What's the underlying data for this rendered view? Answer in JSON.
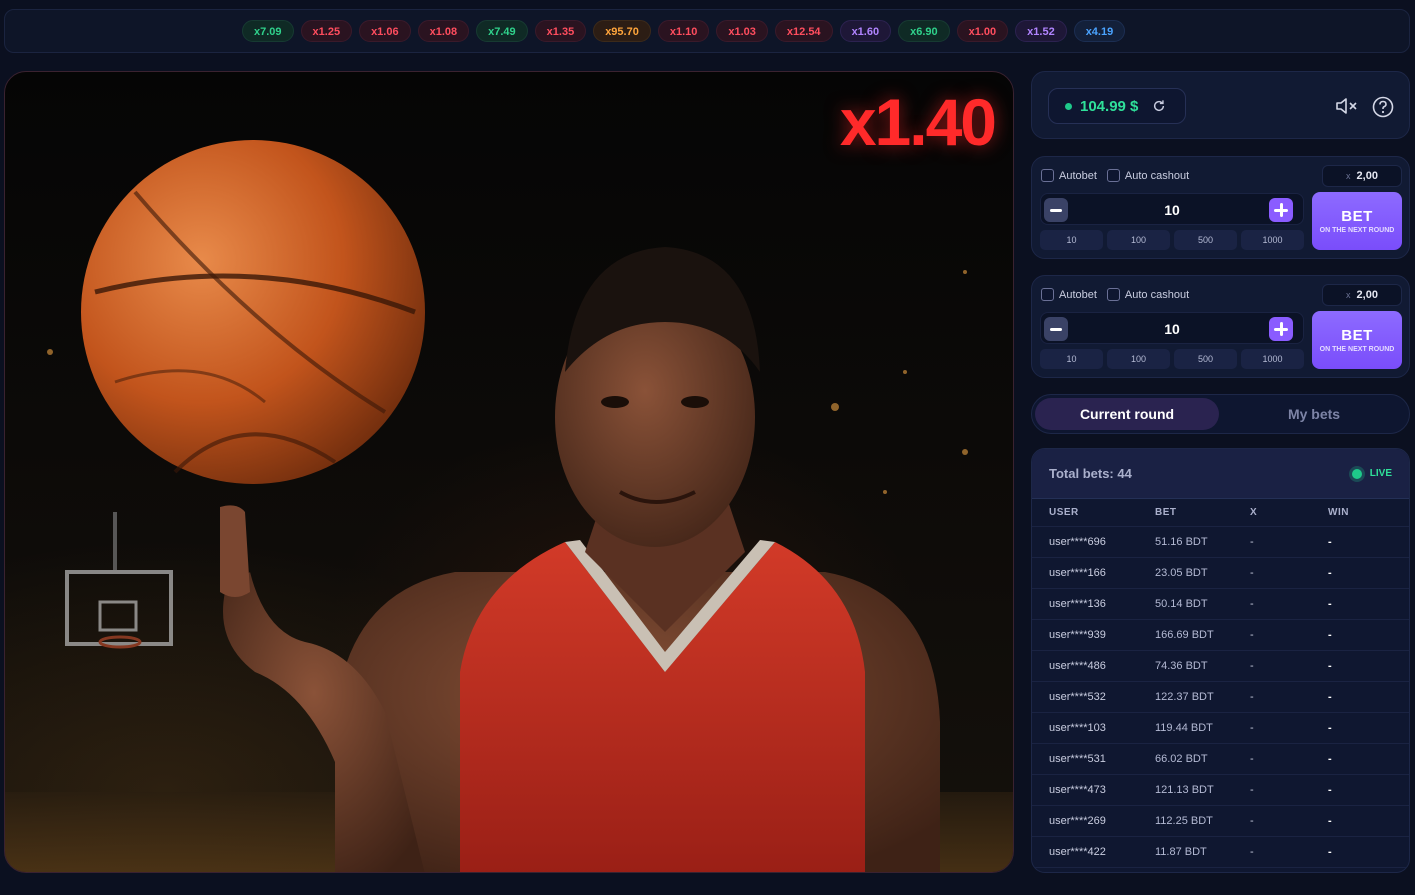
{
  "history": [
    {
      "label": "x7.09",
      "tone": "green"
    },
    {
      "label": "x1.25",
      "tone": "red"
    },
    {
      "label": "x1.06",
      "tone": "red"
    },
    {
      "label": "x1.08",
      "tone": "red"
    },
    {
      "label": "x7.49",
      "tone": "green"
    },
    {
      "label": "x1.35",
      "tone": "red"
    },
    {
      "label": "x95.70",
      "tone": "orange"
    },
    {
      "label": "x1.10",
      "tone": "red"
    },
    {
      "label": "x1.03",
      "tone": "red"
    },
    {
      "label": "x12.54",
      "tone": "red"
    },
    {
      "label": "x1.60",
      "tone": "violet"
    },
    {
      "label": "x6.90",
      "tone": "green"
    },
    {
      "label": "x1.00",
      "tone": "red"
    },
    {
      "label": "x1.52",
      "tone": "violet"
    },
    {
      "label": "x4.19",
      "tone": "blue"
    }
  ],
  "game": {
    "multiplier": "x1.40"
  },
  "account": {
    "balance": "104.99 $",
    "icons": {
      "refresh": "refresh-icon",
      "sound": "sound-muted-icon",
      "help": "help-icon"
    }
  },
  "bets": [
    {
      "autobet": "Autobet",
      "auto_cashout": "Auto cashout",
      "cashout_prefix": "x",
      "cashout_value": "2,00",
      "amount": "10",
      "quick": [
        "10",
        "100",
        "500",
        "1000"
      ],
      "bet_label": "BET",
      "bet_sub": "ON THE NEXT ROUND"
    },
    {
      "autobet": "Autobet",
      "auto_cashout": "Auto cashout",
      "cashout_prefix": "x",
      "cashout_value": "2,00",
      "amount": "10",
      "quick": [
        "10",
        "100",
        "500",
        "1000"
      ],
      "bet_label": "BET",
      "bet_sub": "ON THE NEXT ROUND"
    }
  ],
  "tabs": {
    "current": "Current round",
    "my": "My bets"
  },
  "round": {
    "total_label": "Total bets: 44",
    "live_label": "LIVE",
    "columns": [
      "USER",
      "BET",
      "X",
      "WIN"
    ],
    "rows": [
      {
        "user": "user****696",
        "bet": "51.16 BDT",
        "x": "-",
        "win": "-"
      },
      {
        "user": "user****166",
        "bet": "23.05 BDT",
        "x": "-",
        "win": "-"
      },
      {
        "user": "user****136",
        "bet": "50.14 BDT",
        "x": "-",
        "win": "-"
      },
      {
        "user": "user****939",
        "bet": "166.69 BDT",
        "x": "-",
        "win": "-"
      },
      {
        "user": "user****486",
        "bet": "74.36 BDT",
        "x": "-",
        "win": "-"
      },
      {
        "user": "user****532",
        "bet": "122.37 BDT",
        "x": "-",
        "win": "-"
      },
      {
        "user": "user****103",
        "bet": "119.44 BDT",
        "x": "-",
        "win": "-"
      },
      {
        "user": "user****531",
        "bet": "66.02 BDT",
        "x": "-",
        "win": "-"
      },
      {
        "user": "user****473",
        "bet": "121.13 BDT",
        "x": "-",
        "win": "-"
      },
      {
        "user": "user****269",
        "bet": "112.25 BDT",
        "x": "-",
        "win": "-"
      },
      {
        "user": "user****422",
        "bet": "11.87 BDT",
        "x": "-",
        "win": "-"
      }
    ]
  },
  "colors": {
    "accent": "#8a5cff",
    "balance": "#2fe09a",
    "multiplier": "#ff2a2a",
    "live": "#1ec98a"
  }
}
